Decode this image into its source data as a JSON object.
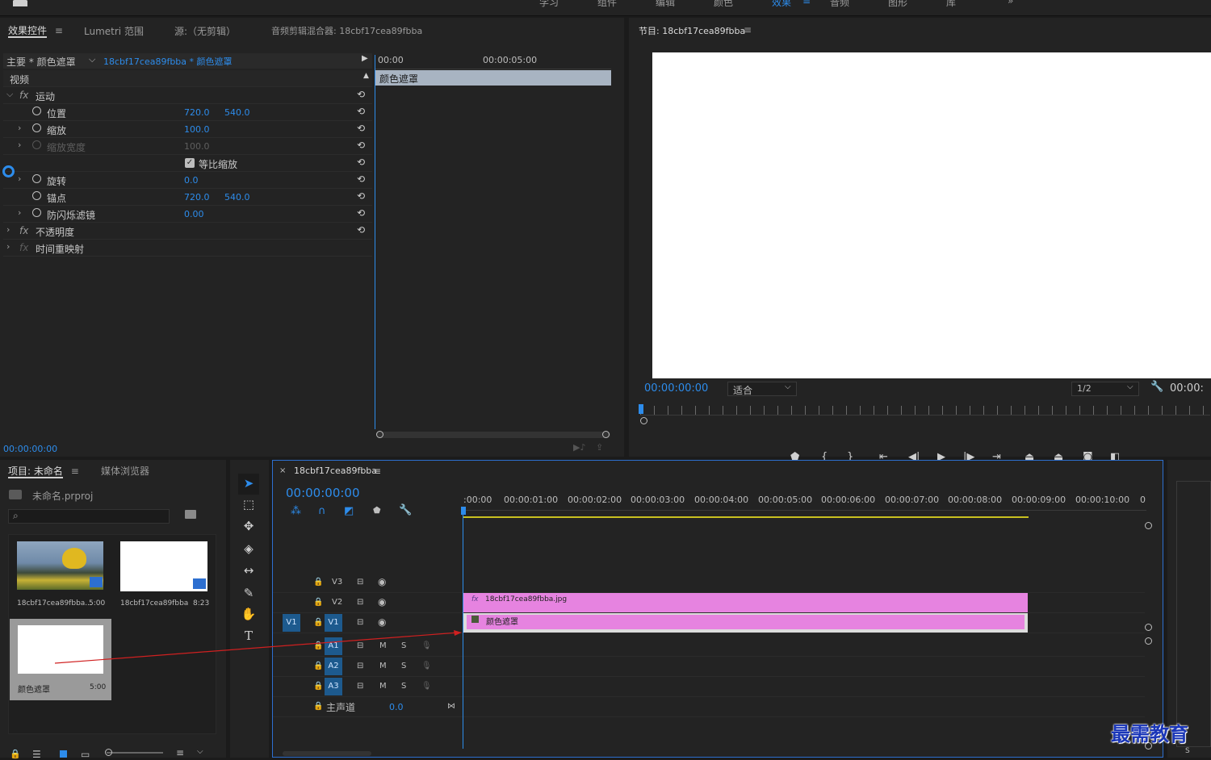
{
  "topbar": {
    "items": [
      "学习",
      "组件",
      "编辑",
      "颜色",
      "效果",
      "音频",
      "图形",
      "库"
    ],
    "more": "»"
  },
  "effects": {
    "tabs": [
      "效果控件",
      "Lumetri 范围",
      "源:（无剪辑）",
      "音频剪辑混合器: 18cbf17cea89fbba"
    ],
    "menu_glyph": "≡",
    "header": {
      "master": "主要 * 颜色遮罩",
      "seq": "18cbf17cea89fbba * 颜色遮罩"
    },
    "section": "视频",
    "motion": "运动",
    "fx": "fx",
    "props": [
      {
        "label": "位置",
        "v1": "720.0",
        "v2": "540.0"
      },
      {
        "label": "缩放",
        "v1": "100.0"
      },
      {
        "label": "缩放宽度",
        "v1": "100.0"
      },
      {
        "label": "等比缩放"
      },
      {
        "label": "旋转",
        "v1": "0.0"
      },
      {
        "label": "锚点",
        "v1": "720.0",
        "v2": "540.0"
      },
      {
        "label": "防闪烁滤镜",
        "v1": "0.00"
      }
    ],
    "opacity": "不透明度",
    "timeremap": "时间重映射",
    "mini_ruler": [
      "00:00",
      "00:00:05:00"
    ],
    "clip_label": "颜色遮罩",
    "timecode": "00:00:00:00"
  },
  "program": {
    "title": "节目: 18cbf17cea89fbba",
    "timecode": "00:00:00:00",
    "fit": "适合",
    "res": "1/2",
    "tc_right": "00:00:"
  },
  "project": {
    "tabs": [
      "项目: 未命名",
      "媒体浏览器"
    ],
    "file": "未命名.prproj",
    "search_placeholder": "",
    "items": [
      {
        "name": "18cbf17cea89fbba...",
        "dur": "5:00"
      },
      {
        "name": "18cbf17cea89fbba",
        "dur": "8:23"
      },
      {
        "name": "颜色遮罩",
        "dur": "5:00"
      }
    ]
  },
  "timeline": {
    "close": "×",
    "seq_name": "18cbf17cea89fbba",
    "timecode": "00:00:00:00",
    "ruler": [
      ":00:00",
      "00:00:01:00",
      "00:00:02:00",
      "00:00:03:00",
      "00:00:04:00",
      "00:00:05:00",
      "00:00:06:00",
      "00:00:07:00",
      "00:00:08:00",
      "00:00:09:00",
      "00:00:10:00",
      "0"
    ],
    "tracks": {
      "v3": "V3",
      "v2": "V2",
      "v1": "V1",
      "src_v1": "V1",
      "a1": "A1",
      "a2": "A2",
      "a3": "A3",
      "m": "M",
      "s": "S"
    },
    "master": {
      "label": "主声道",
      "value": "0.0"
    },
    "clips": {
      "jpg": "18cbf17cea89fbba.jpg",
      "matte": "颜色遮罩",
      "fx": "fx"
    }
  },
  "watermark": "最需教育",
  "colors": {
    "accent": "#2d8ceb",
    "clip": "#e683e0",
    "clip_bar": "#a8b4c2",
    "playhead": "#2d8ceb"
  }
}
